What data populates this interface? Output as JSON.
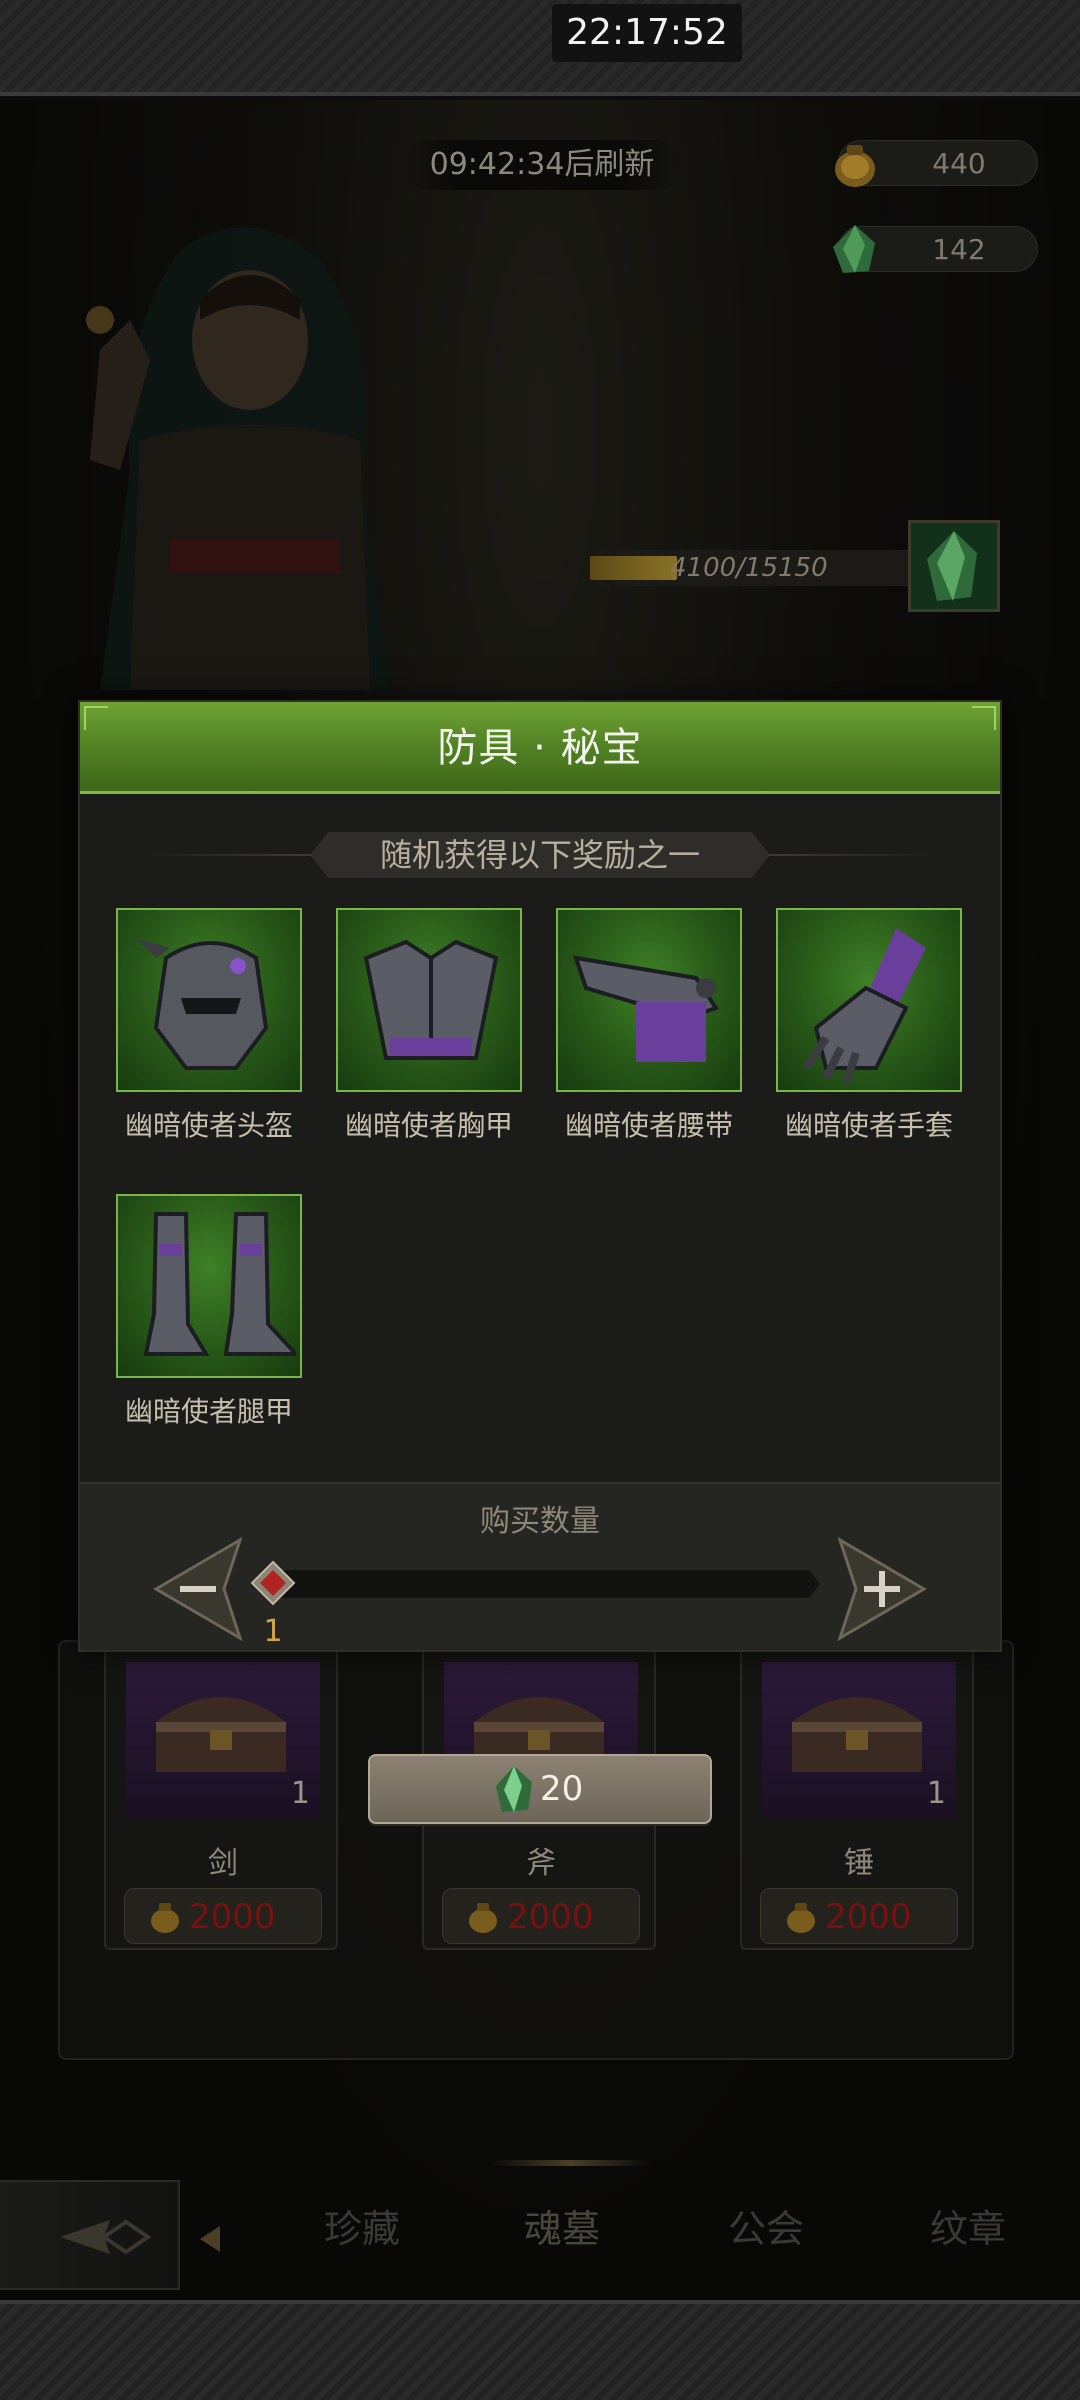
{
  "status": {
    "time": "22:17:52"
  },
  "shop": {
    "refresh_timer": "09:42:34后刷新",
    "currency": {
      "gold": "440",
      "gem": "142"
    },
    "progress": {
      "text": "4100/15150",
      "current": 4100,
      "max": 15150
    },
    "cards": [
      {
        "name": "剑",
        "qty": "1",
        "price": "2000"
      },
      {
        "name": "斧",
        "qty": "",
        "price": "2000"
      },
      {
        "name": "锤",
        "qty": "1",
        "price": "2000"
      }
    ],
    "cost": "20"
  },
  "dialog": {
    "title": "防具 · 秘宝",
    "subtitle": "随机获得以下奖励之一",
    "rewards": [
      {
        "name": "幽暗使者头盔",
        "icon": "helmet-icon"
      },
      {
        "name": "幽暗使者胸甲",
        "icon": "chest-armor-icon"
      },
      {
        "name": "幽暗使者腰带",
        "icon": "belt-icon"
      },
      {
        "name": "幽暗使者手套",
        "icon": "gauntlet-icon"
      },
      {
        "name": "幽暗使者腿甲",
        "icon": "greaves-icon"
      }
    ],
    "quantity": {
      "title": "购买数量",
      "value": "1"
    }
  },
  "nav": {
    "tabs": [
      "珍藏",
      "魂墓",
      "公会",
      "纹章"
    ],
    "active": "魂墓"
  },
  "colors": {
    "header_green": "#4f7e22",
    "frame_green": "#78b64b",
    "price_red": "#7a1010",
    "qty_gold": "#d3a544"
  }
}
